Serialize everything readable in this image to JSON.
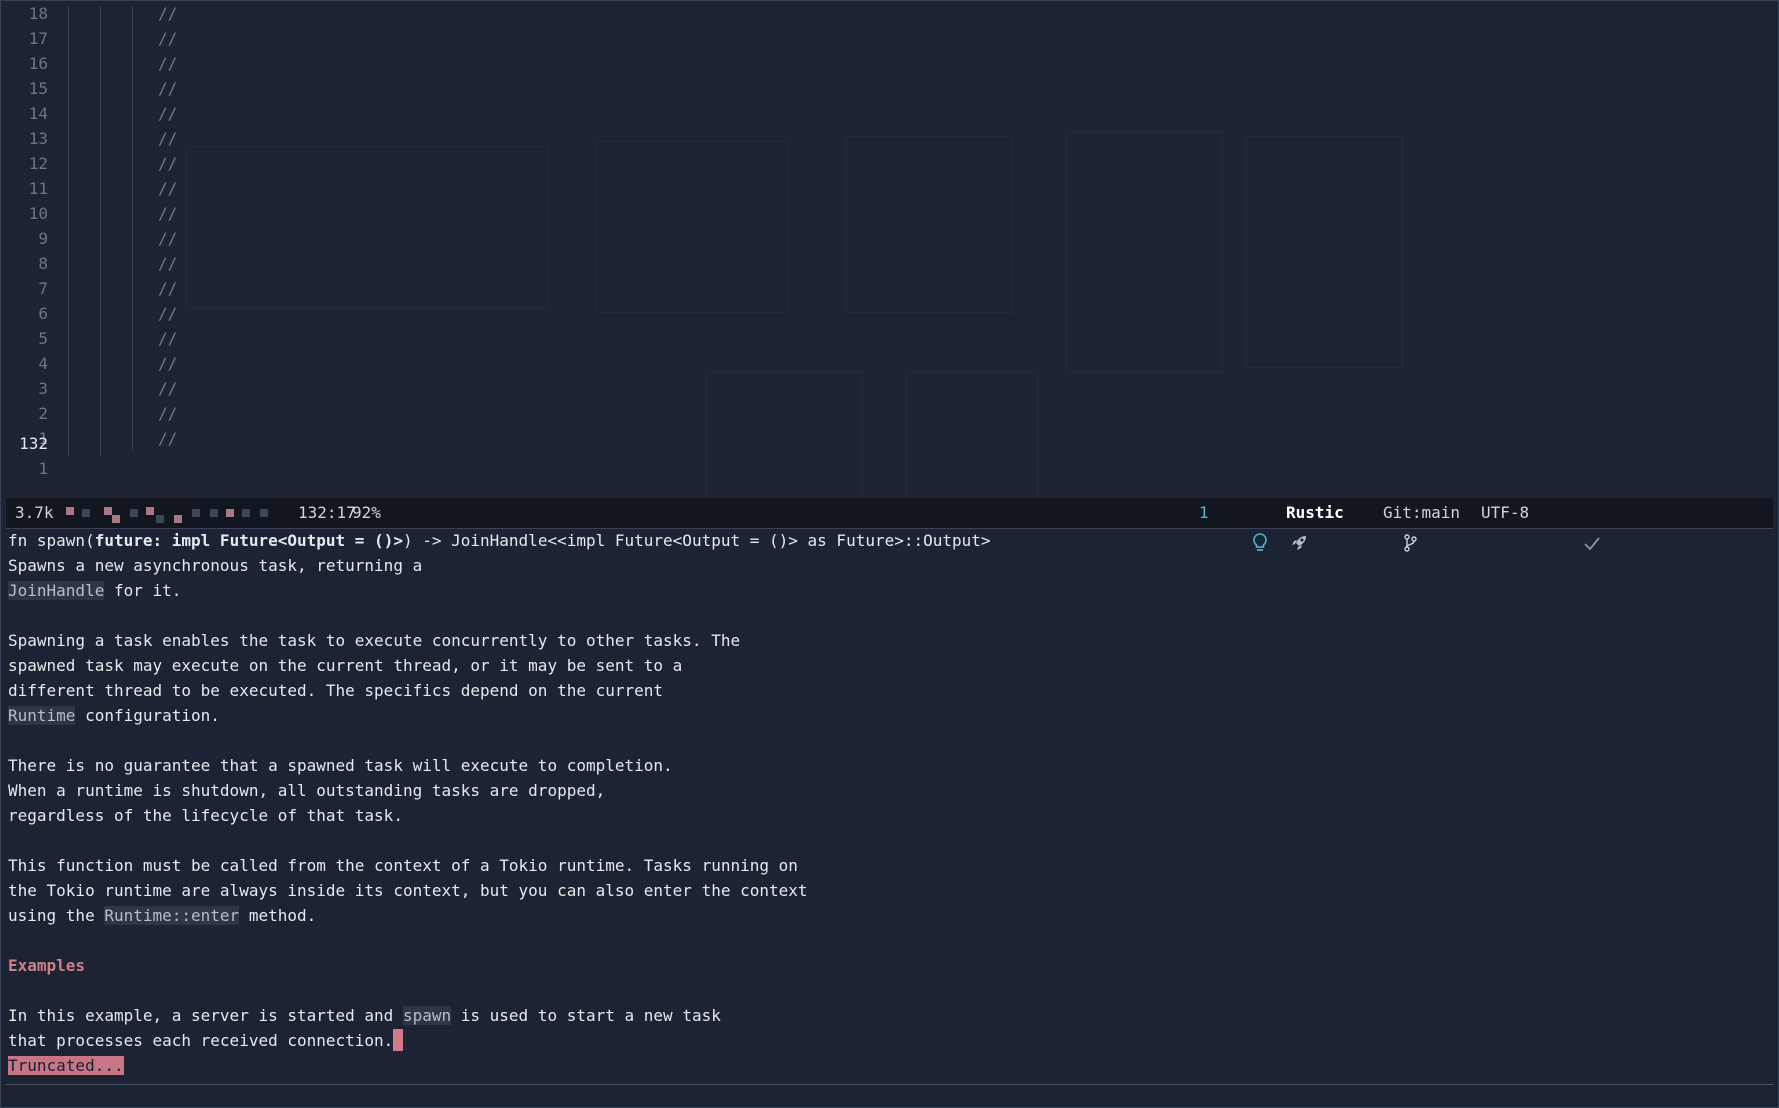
{
  "editor": {
    "relative_line_numbers": [
      "18",
      "17",
      "16",
      "15",
      "14",
      "13",
      "12",
      "11",
      "10",
      "9",
      "8",
      "7",
      "6",
      "5",
      "4",
      "3",
      "2",
      "1"
    ],
    "comment_text": "//",
    "current_line_number": "132",
    "current_line_comment": "//",
    "current_line_cursor_text": "(",
    "next_line_number": "1",
    "next_line_code": "});"
  },
  "statusbar": {
    "file_size": "3.7k",
    "position": "132:17",
    "percent": "92%",
    "diagnostics_count": "1",
    "bulb_icon": "lightbulb-icon",
    "rocket_icon": "rocket-icon",
    "mode": "Rustic",
    "git_icon": "git-branch-icon",
    "git_branch": "Git:main",
    "encoding": "UTF-8",
    "check_icon": "check-icon"
  },
  "doc": {
    "sig_prefix": "fn spawn(",
    "sig_param": "future: impl Future<Output = ()>",
    "sig_suffix": ") -> JoinHandle<<impl Future<Output = ()> as Future>::Output>",
    "l1": "Spawns a new asynchronous task, returning a",
    "l2_code": "JoinHandle",
    "l2_rest": " for it.",
    "p2": [
      "Spawning a task enables the task to execute concurrently to other tasks. The",
      "spawned task may execute on the current thread, or it may be sent to a",
      "different thread to be executed. The specifics depend on the current"
    ],
    "p2_last_code": "Runtime",
    "p2_last_rest": " configuration.",
    "p3": [
      "There is no guarantee that a spawned task will execute to completion.",
      "When a runtime is shutdown, all outstanding tasks are dropped,",
      "regardless of the lifecycle of that task."
    ],
    "p4": [
      "This function must be called from the context of a Tokio runtime. Tasks running on",
      "the Tokio runtime are always inside its context, but you can also enter the context"
    ],
    "p4_last_pre": "using the ",
    "p4_last_code": "Runtime::enter",
    "p4_last_rest": " method.",
    "examples_heading": "Examples",
    "p5_pre": "In this example, a server is started and ",
    "p5_code": "spawn",
    "p5_rest": " is used to start a new task",
    "p5_l2": "that processes each received connection.",
    "truncated": "Truncated..."
  },
  "colors": {
    "background": "#1c2333",
    "statusbar": "#12171f",
    "accent": "#d07a8a",
    "info": "#58b6d8"
  }
}
